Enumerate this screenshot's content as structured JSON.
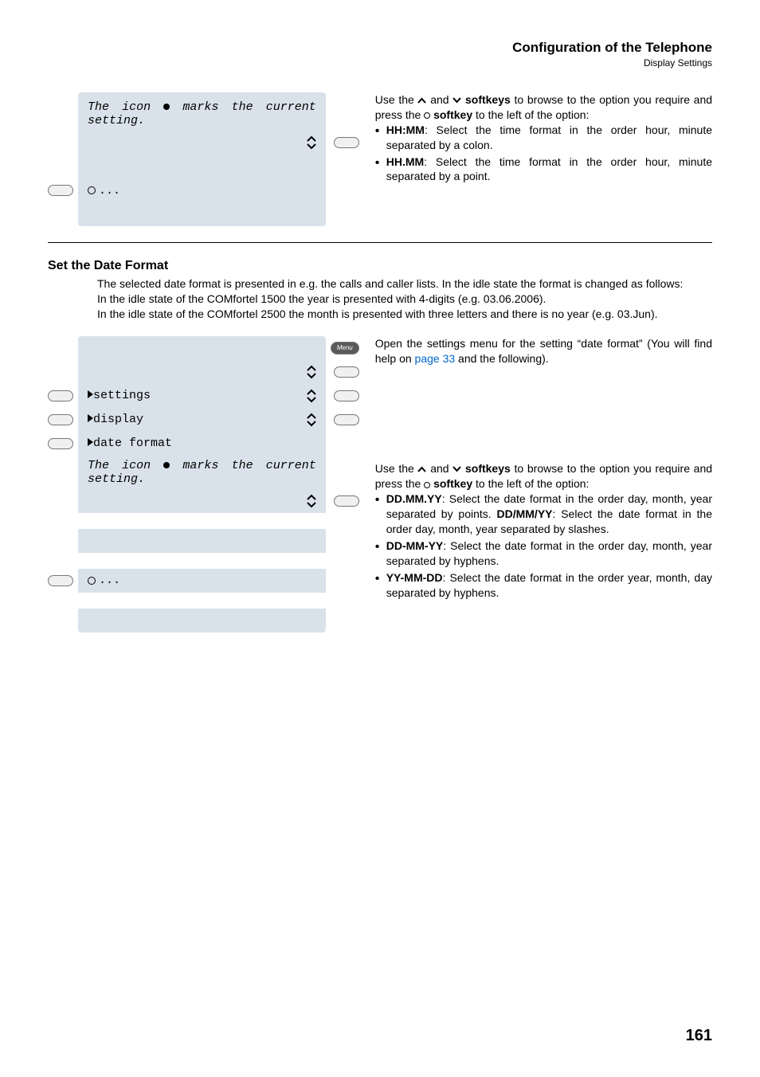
{
  "header": {
    "title": "Configuration of the Telephone",
    "subtitle": "Display Settings"
  },
  "diagram1": {
    "italic_prefix": "The icon ",
    "italic_suffix": " marks the current setting.",
    "dots": "..."
  },
  "rightText1": {
    "line1_prefix": "Use the ",
    "line1_mid": " and ",
    "line1_suffix_bold": "softkeys",
    "line1_end": " to browse to the option you require and press the ",
    "line1_softkey": "softkey",
    "line1_close": " to the left of the option:",
    "bullets": [
      {
        "bold": "HH:MM",
        "rest": ": Select the time format in the order hour, minute separated by a colon."
      },
      {
        "bold": "HH.MM",
        "rest": ": Select the time format in the order hour, minute separated by a point."
      }
    ]
  },
  "section2": {
    "heading": "Set the Date Format",
    "para1": "The selected date format is presented in e.g. the calls and caller lists. In the idle state the format is changed as follows:",
    "para2": "In the idle state of the COMfortel 1500 the year is presented with 4-digits (e.g. 03.06.2006).",
    "para3": "In the idle state of the COMfortel 2500 the month is presented with three letters and there is no year (e.g. 03.Jun)."
  },
  "diagram2": {
    "menu_label": "Menu",
    "row_settings": "settings",
    "row_display": "display",
    "row_dateformat": "date format",
    "italic_prefix": "The icon ",
    "italic_suffix": " marks the current setting.",
    "dots": "..."
  },
  "rightText2a": {
    "text_prefix": "Open the settings menu for the setting “date format” (You will find help on ",
    "link": "page 33",
    "text_suffix": " and the following)."
  },
  "rightText2b": {
    "line1_prefix": "Use the ",
    "line1_mid": " and ",
    "line1_suffix_bold": "softkeys",
    "line1_end": " to browse to the option you require and press the ",
    "line1_softkey": "softkey",
    "line1_close": " to the left of the option:",
    "bullets": [
      {
        "bold": "DD.MM.YY",
        "rest": ": Select the date format in the order day, month, year separated by points.",
        "bold2": "DD/MM/YY",
        "rest2": ": Select the date format in the order day, month, year separated by slashes."
      },
      {
        "bold": "DD-MM-YY",
        "rest": ": Select the date format in the order day, month, year separated by hyphens."
      },
      {
        "bold": "YY-MM-DD",
        "rest": ": Select the date format in the order year, month, day separated by hyphens."
      }
    ]
  },
  "pageNum": "161"
}
